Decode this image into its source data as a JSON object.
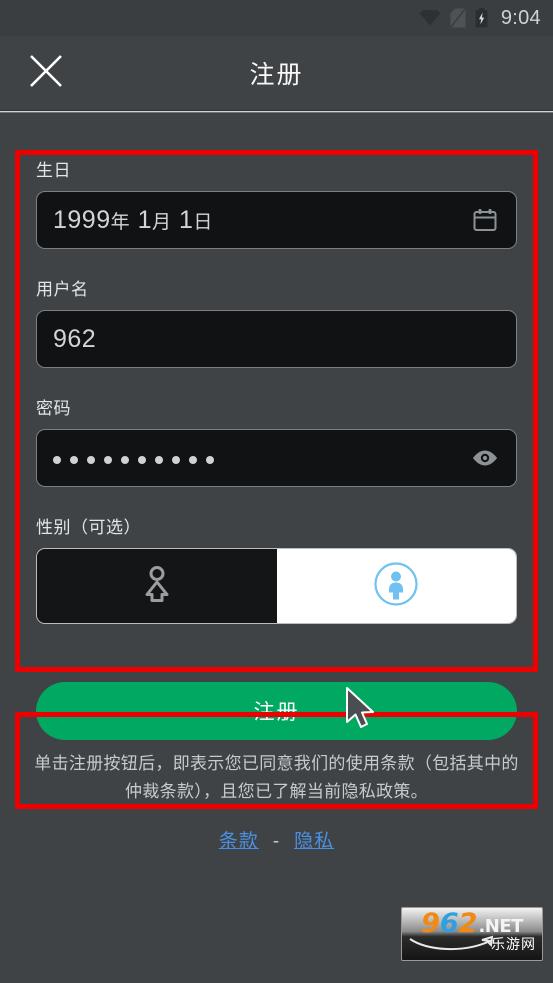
{
  "statusbar": {
    "time": "9:04",
    "icons": [
      "wifi-icon",
      "no-sim-icon",
      "battery-charging-icon"
    ]
  },
  "header": {
    "title": "注册",
    "close_icon": "close-icon"
  },
  "form": {
    "birthday": {
      "label": "生日",
      "value_year": "1999",
      "value_year_unit": "年",
      "value_month": " 1",
      "value_month_unit": "月",
      "value_day": " 1",
      "value_day_unit": "日",
      "icon": "calendar-icon"
    },
    "username": {
      "label": "用户名",
      "value": "962",
      "placeholder": "用户名"
    },
    "password": {
      "label": "密码",
      "value": "••••••••••",
      "dot_count": 10,
      "placeholder": "密码",
      "icon": "eye-icon"
    },
    "gender": {
      "label": "性别（可选）",
      "options": [
        {
          "name": "female",
          "icon": "person-outline-icon",
          "selected": false
        },
        {
          "name": "male",
          "icon": "person-circle-icon",
          "selected": true
        }
      ]
    }
  },
  "submit": {
    "label": "注册"
  },
  "terms": {
    "text": "单击注册按钮后，即表示您已同意我们的使用条款（包括其中的仲裁条款），且您已了解当前隐私政策。",
    "link_terms": "条款",
    "separator": "-",
    "link_privacy": "隐私"
  },
  "watermark": {
    "digits_1": "9",
    "digits_2": "6",
    "digits_3": "2",
    "suffix": ".NET",
    "cn": "乐游网"
  },
  "colors": {
    "background": "#3f4346",
    "input_background": "#111214",
    "accent_green": "#00a862",
    "link_blue": "#4a90e2",
    "selected_icon_blue": "#6ec1f0",
    "annotation_red": "#ee0000"
  }
}
